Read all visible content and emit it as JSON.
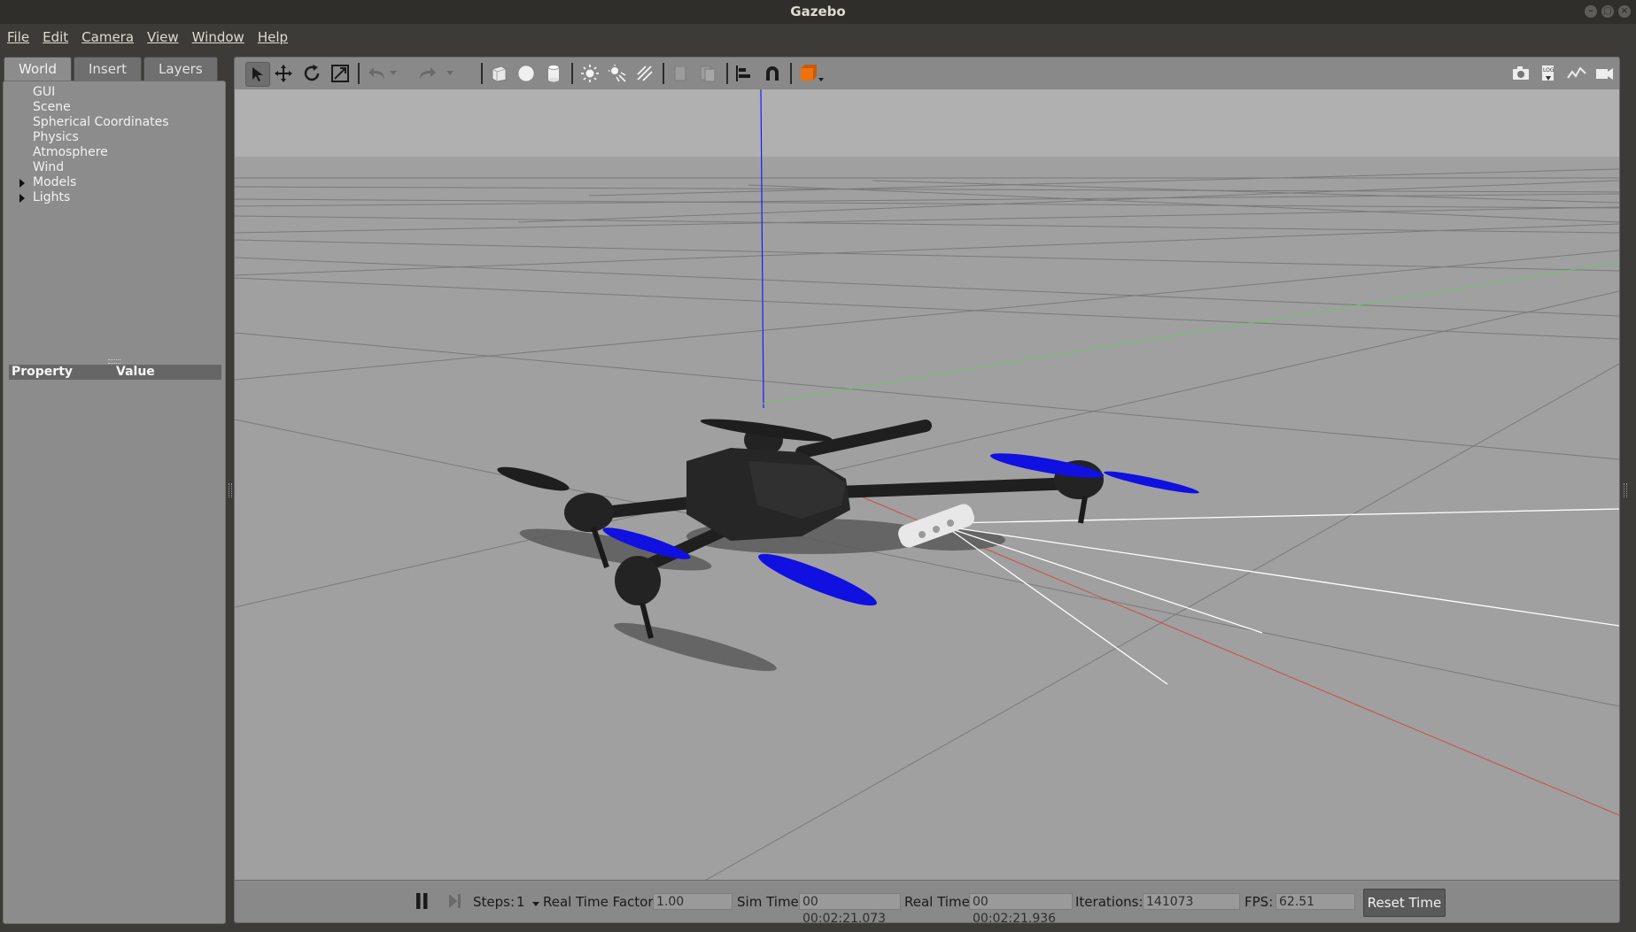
{
  "window": {
    "title": "Gazebo"
  },
  "menu": [
    {
      "label": "File"
    },
    {
      "label": "Edit"
    },
    {
      "label": "Camera"
    },
    {
      "label": "View"
    },
    {
      "label": "Window"
    },
    {
      "label": "Help"
    }
  ],
  "left_panel": {
    "tabs": [
      {
        "label": "World",
        "active": true
      },
      {
        "label": "Insert"
      },
      {
        "label": "Layers"
      }
    ],
    "tree": [
      {
        "label": "GUI"
      },
      {
        "label": "Scene"
      },
      {
        "label": "Spherical Coordinates"
      },
      {
        "label": "Physics"
      },
      {
        "label": "Atmosphere"
      },
      {
        "label": "Wind"
      },
      {
        "label": "Models",
        "expandable": true
      },
      {
        "label": "Lights",
        "expandable": true
      }
    ],
    "property_table": {
      "col_property": "Property",
      "col_value": "Value"
    }
  },
  "toolbar": {
    "tools": [
      "select-arrow-icon",
      "translate-icon",
      "rotate-icon",
      "scale-icon",
      "undo-icon",
      "undo-history-icon",
      "redo-icon",
      "redo-history-icon",
      "box-shape-icon",
      "sphere-shape-icon",
      "cylinder-shape-icon",
      "point-light-icon",
      "spot-light-icon",
      "directional-light-icon",
      "copy-icon",
      "paste-icon",
      "align-icon",
      "snap-icon",
      "view-angle-icon"
    ],
    "right_tools": [
      "screenshot-icon",
      "log-icon",
      "plot-icon",
      "record-video-icon"
    ]
  },
  "bottom_bar": {
    "steps_label": "Steps:",
    "steps_value": "1",
    "rtf_label": "Real Time Factor:",
    "rtf_value": "1.00",
    "sim_time_label": "Sim Time:",
    "sim_time_value": "00 00:02:21.073",
    "real_time_label": "Real Time:",
    "real_time_value": "00 00:02:21.936",
    "iterations_label": "Iterations:",
    "iterations_value": "141073",
    "fps_label": "FPS:",
    "fps_value": "62.51",
    "reset_label": "Reset Time"
  },
  "colors": {
    "propeller": "#1010e0",
    "axis_x": "#d04a4a",
    "axis_y": "#6ec26e",
    "axis_z": "#1a1aff",
    "drone_body": "#262626"
  }
}
